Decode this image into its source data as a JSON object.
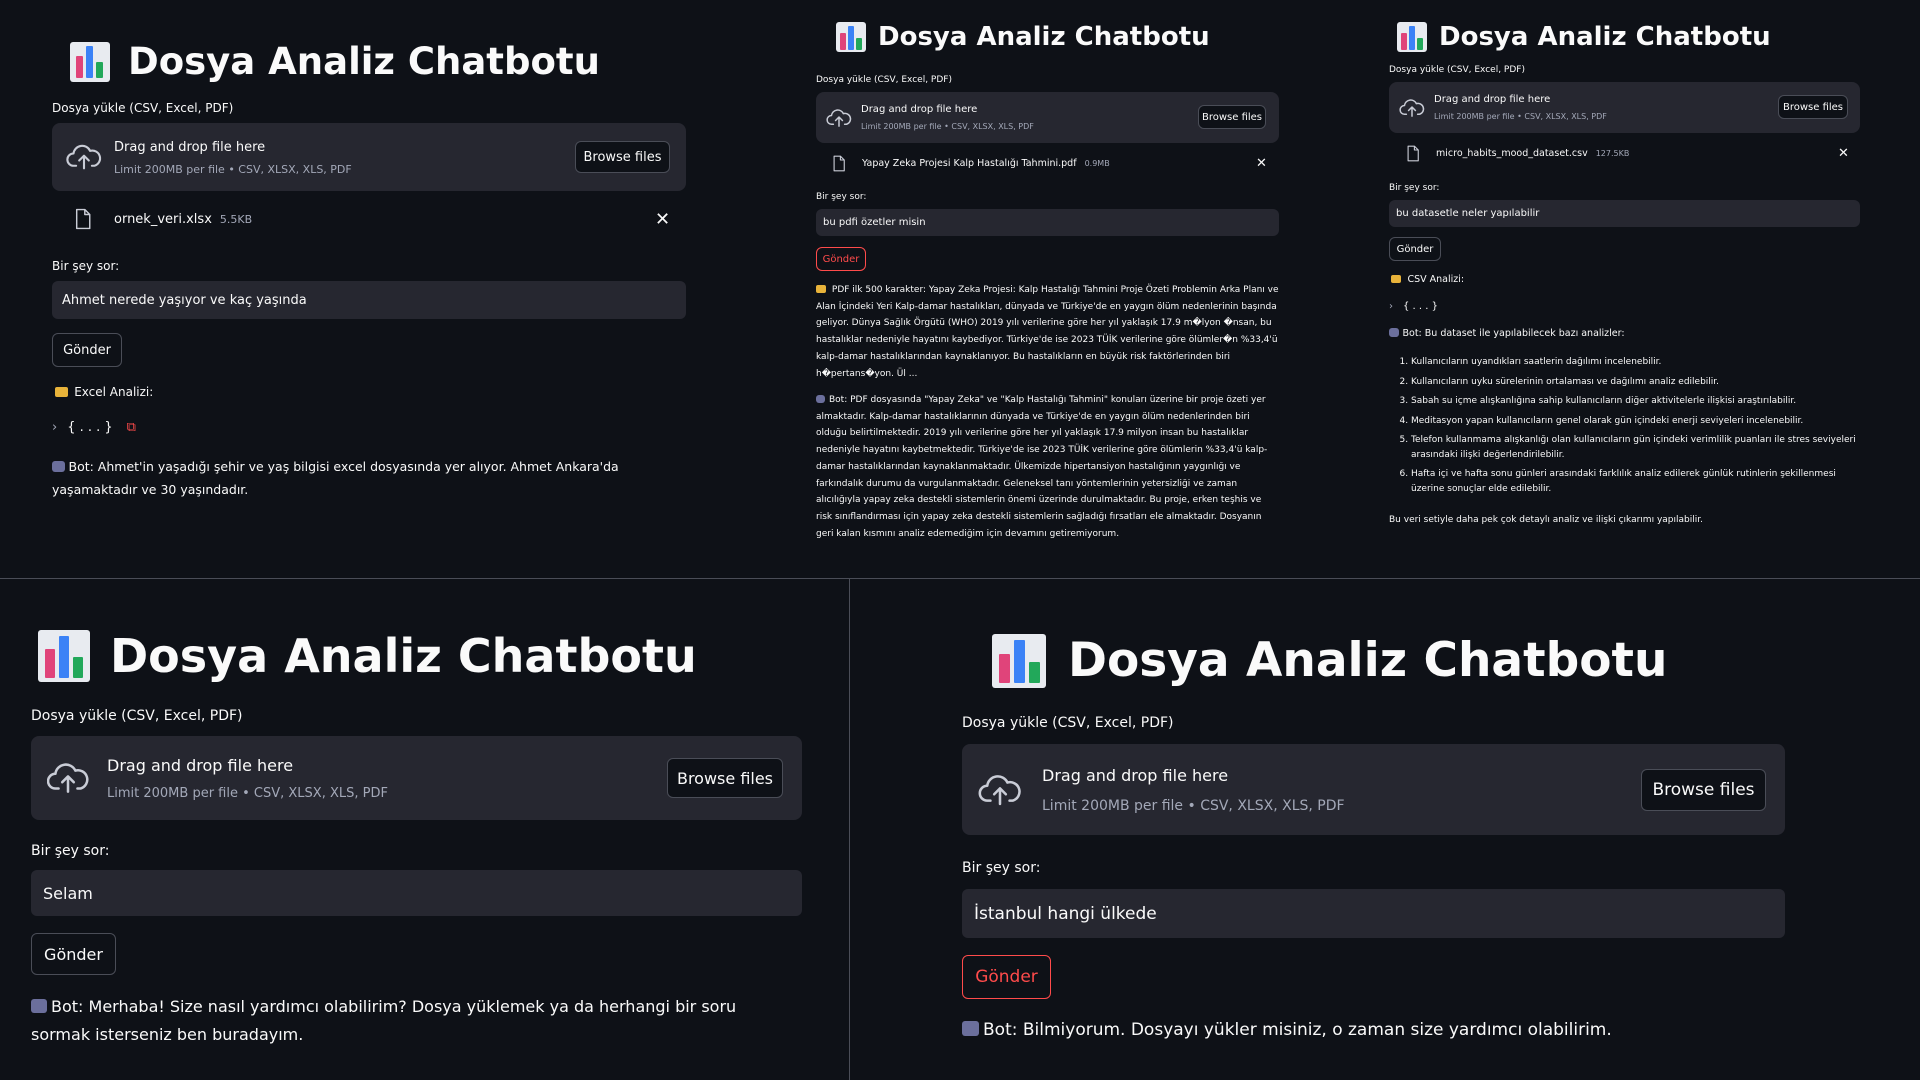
{
  "app": {
    "title": "Dosya Analiz Chatbotu",
    "upload_label": "Dosya yükle (CSV, Excel, PDF)",
    "dropzone_title": "Drag and drop file here",
    "dropzone_limit": "Limit 200MB per file • CSV, XLSX, XLS, PDF",
    "browse_label": "Browse files",
    "question_label": "Bir şey sor:",
    "send_label": "Gönder"
  },
  "icons": {
    "logo": "bar-chart-icon",
    "upload": "cloud-upload-icon",
    "file": "file-icon",
    "close": "close-icon",
    "bot": "robot-icon",
    "folder": "folder-icon"
  },
  "colors": {
    "background": "#0e1117",
    "surface": "#262730",
    "accent": "#ff4b4b",
    "muted": "#a3a8b8"
  },
  "screens": [
    {
      "file_name": "ornek_veri.xlsx",
      "file_size": "5.5KB",
      "question": "Ahmet nerede yaşıyor ve kaç yaşında",
      "analysis_label": "Excel Analizi:",
      "json_collapsed": "{ . . . }",
      "bot_text": "Bot: Ahmet'in yaşadığı şehir ve yaş bilgisi excel dosyasında yer alıyor. Ahmet Ankara'da yaşamaktadır ve 30 yaşındadır."
    },
    {
      "file_name": "Yapay Zeka Projesi Kalp Hastalığı Tahmini.pdf",
      "file_size": "0.9MB",
      "question": "bu pdfi özetler misin",
      "pdf_text": "PDF ilk 500 karakter: Yapay Zeka Projesi: Kalp Hastalığı Tahmini Proje Özeti Problemin Arka Planı ve Alan İçindeki Yeri Kalp-damar hastalıkları, dünyada ve Türkiye'de en yaygın ölüm nedenlerinin başında geliyor. Dünya Sağlık Örgütü (WHO) 2019 yılı verilerine göre her yıl yaklaşık 17.9 m�lyon �nsan, bu hastalıklar nedeniyle hayatını kaybediyor. Türkiye'de ise 2023 TÜİK verilerine göre ölümler�n %33,4'ü kalp-damar hastalıklarından kaynaklanıyor. Bu hastalıkların en büyük risk faktörlerinden biri h�pertans�yon. Ül ...",
      "bot_text": "Bot: PDF dosyasında \"Yapay Zeka\" ve \"Kalp Hastalığı Tahmini\" konuları üzerine bir proje özeti yer almaktadır. Kalp-damar hastalıklarının dünyada ve Türkiye'de en yaygın ölüm nedenlerinden biri olduğu belirtilmektedir. 2019 yılı verilerine göre her yıl yaklaşık 17.9 milyon insan bu hastalıklar nedeniyle hayatını kaybetmektedir. Türkiye'de ise 2023 TÜİK verilerine göre ölümlerin %33,4'ü kalp-damar hastalıklarından kaynaklanmaktadır. Ülkemizde hipertansiyon hastalığının yaygınlığı ve farkındalık durumu da vurgulanmaktadır. Geleneksel tanı yöntemlerinin yetersizliği ve zaman alıcılığıyla yapay zeka destekli sistemlerin önemi üzerinde durulmaktadır. Bu proje, erken teşhis ve risk sınıflandırması için yapay zeka destekli sistemlerin sağladığı fırsatları ele almaktadır. Dosyanın geri kalan kısmını analiz edemediğim için devamını getiremiyorum."
    },
    {
      "file_name": "micro_habits_mood_dataset.csv",
      "file_size": "127.5KB",
      "question": "bu datasetle neler yapılabilir",
      "analysis_label": "CSV Analizi:",
      "json_collapsed": "{ . . . }",
      "bot_intro": "Bot: Bu dataset ile yapılabilecek bazı analizler:",
      "list": [
        "Kullanıcıların uyandıkları saatlerin dağılımı incelenebilir.",
        "Kullanıcıların uyku sürelerinin ortalaması ve dağılımı analiz edilebilir.",
        "Sabah su içme alışkanlığına sahip kullanıcıların diğer aktivitelerle ilişkisi araştırılabilir.",
        "Meditasyon yapan kullanıcıların genel olarak gün içindeki enerji seviyeleri incelenebilir.",
        "Telefon kullanmama alışkanlığı olan kullanıcıların gün içindeki verimlilik puanları ile stres seviyeleri arasındaki ilişki değerlendirilebilir.",
        "Hafta içi ve hafta sonu günleri arasındaki farklılık analiz edilerek günlük rutinlerin şekillenmesi üzerine sonuçlar elde edilebilir."
      ],
      "bot_outro": "Bu veri setiyle daha pek çok detaylı analiz ve ilişki çıkarımı yapılabilir."
    },
    {
      "question": "Selam",
      "bot_text": "Bot: Merhaba! Size nasıl yardımcı olabilirim? Dosya yüklemek ya da herhangi bir soru sormak isterseniz ben buradayım."
    },
    {
      "question": "İstanbul hangi ülkede",
      "bot_text": "Bot: Bilmiyorum. Dosyayı yükler misiniz, o zaman size yardımcı olabilirim."
    }
  ]
}
